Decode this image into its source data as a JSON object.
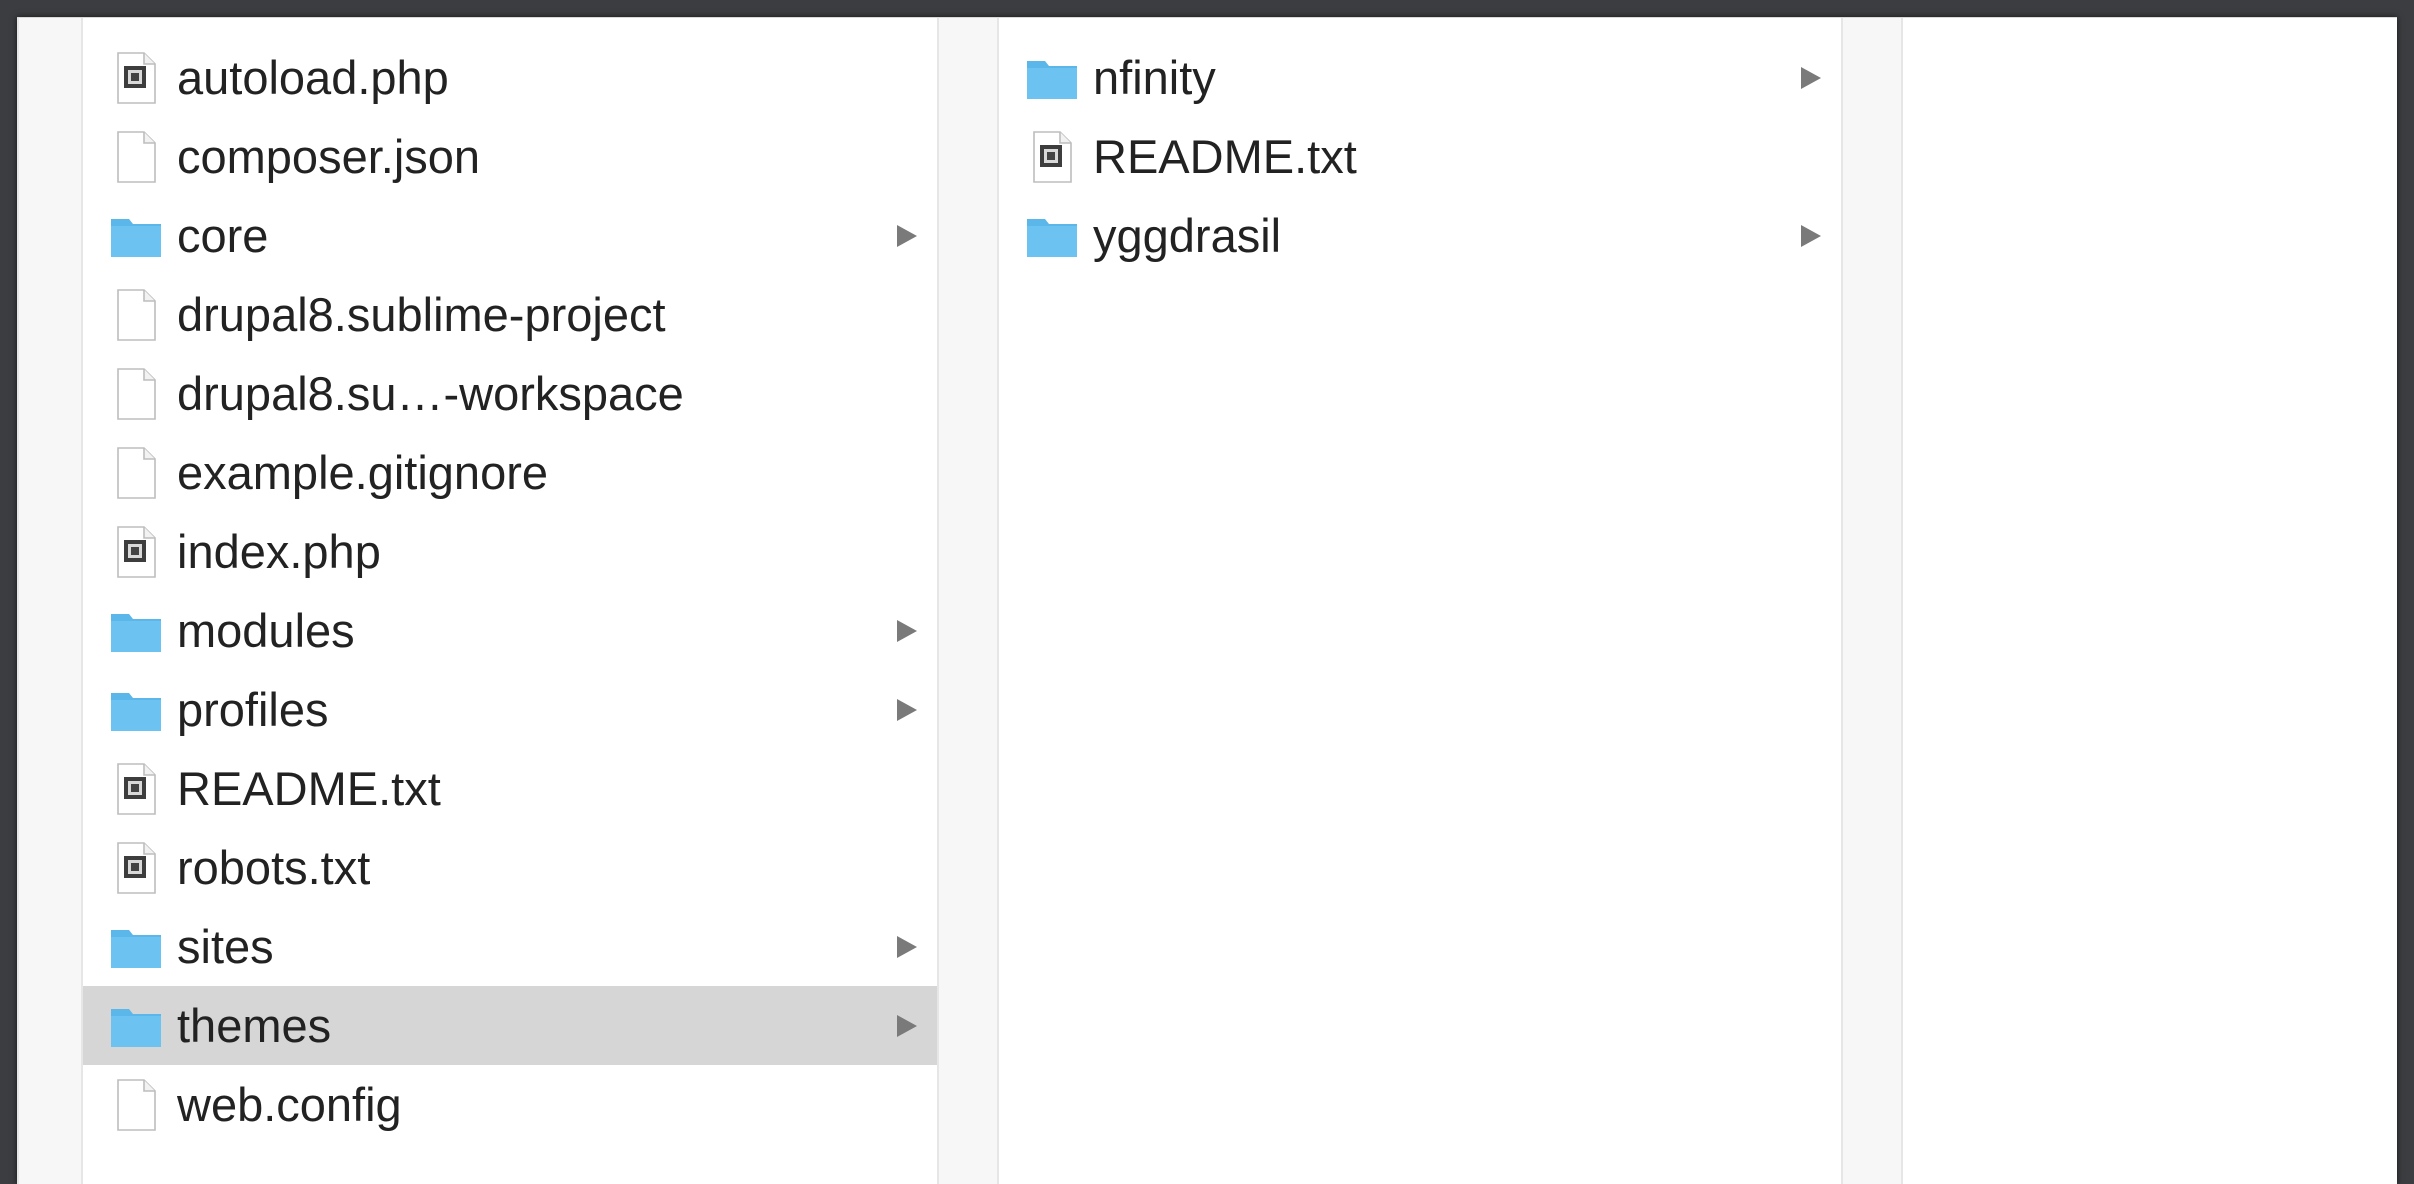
{
  "columns": [
    {
      "items": [
        {
          "name": "autoload.php",
          "kind": "script",
          "folder": false
        },
        {
          "name": "composer.json",
          "kind": "doc",
          "folder": false
        },
        {
          "name": "core",
          "kind": "folder",
          "folder": true
        },
        {
          "name": "drupal8.sublime-project",
          "kind": "doc",
          "folder": false
        },
        {
          "name": "drupal8.su…-workspace",
          "kind": "doc",
          "folder": false
        },
        {
          "name": "example.gitignore",
          "kind": "doc",
          "folder": false
        },
        {
          "name": "index.php",
          "kind": "script",
          "folder": false
        },
        {
          "name": "modules",
          "kind": "folder",
          "folder": true
        },
        {
          "name": "profiles",
          "kind": "folder",
          "folder": true
        },
        {
          "name": "README.txt",
          "kind": "script",
          "folder": false
        },
        {
          "name": "robots.txt",
          "kind": "script",
          "folder": false
        },
        {
          "name": "sites",
          "kind": "folder",
          "folder": true
        },
        {
          "name": "themes",
          "kind": "folder",
          "folder": true,
          "selected": true
        },
        {
          "name": "web.config",
          "kind": "doc",
          "folder": false
        }
      ]
    },
    {
      "items": [
        {
          "name": "nfinity",
          "kind": "folder",
          "folder": true
        },
        {
          "name": "README.txt",
          "kind": "script",
          "folder": false
        },
        {
          "name": "yggdrasil",
          "kind": "folder",
          "folder": true
        }
      ]
    }
  ],
  "colors": {
    "folder": "#6cc3f2",
    "folder_tab": "#5bb6ea",
    "selection": "#d6d6d6",
    "arrow": "#7a7a7a"
  },
  "icons": {
    "folder": "folder-icon",
    "doc": "document-icon",
    "script": "executable-file-icon",
    "arrow": "chevron-right-icon"
  }
}
